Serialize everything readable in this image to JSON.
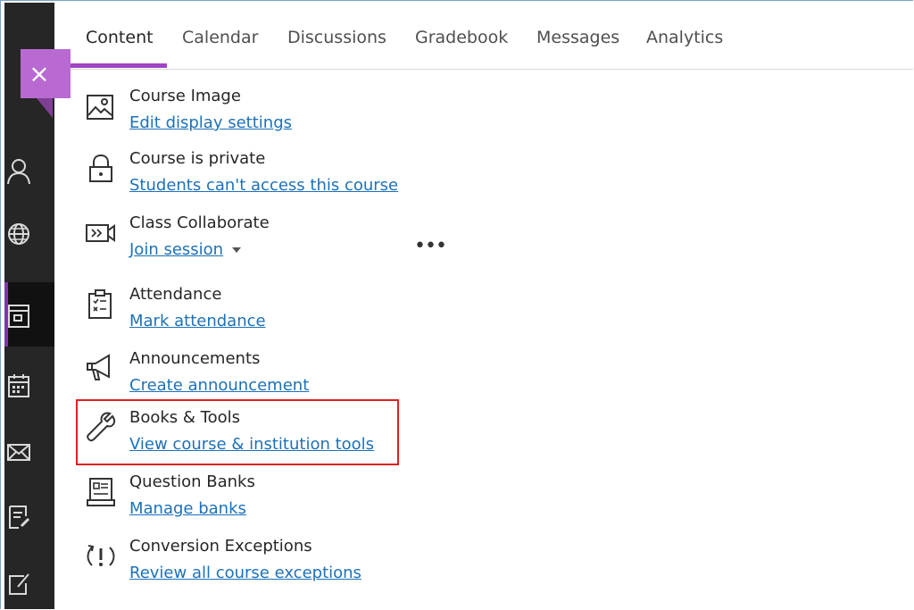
{
  "tabs": [
    {
      "label": "Content",
      "active": true
    },
    {
      "label": "Calendar",
      "active": false
    },
    {
      "label": "Discussions",
      "active": false
    },
    {
      "label": "Gradebook",
      "active": false
    },
    {
      "label": "Messages",
      "active": false
    },
    {
      "label": "Analytics",
      "active": false
    }
  ],
  "close_symbol": "×",
  "accent_color": "#a243c4",
  "link_color": "#1d71b8",
  "items": [
    {
      "title": "Course Image",
      "link": "Edit display settings",
      "icon": "image-icon"
    },
    {
      "title": "Course is private",
      "link": "Students can't access this course",
      "icon": "lock-icon"
    },
    {
      "title": "Class Collaborate",
      "link": "Join session",
      "icon": "video-icon",
      "has_dropdown": true
    },
    {
      "title": "Attendance",
      "link": "Mark attendance",
      "icon": "clipboard-icon"
    },
    {
      "title": "Announcements",
      "link": "Create announcement",
      "icon": "megaphone-icon"
    },
    {
      "title": "Books & Tools",
      "link": "View course & institution tools",
      "icon": "wrench-icon",
      "highlighted": true
    },
    {
      "title": "Question Banks",
      "link": "Manage banks",
      "icon": "question-bank-icon"
    },
    {
      "title": "Conversion Exceptions",
      "link": "Review all course exceptions",
      "icon": "exception-icon"
    }
  ],
  "more_symbol": "•••",
  "rail_icons": [
    "profile-icon",
    "globe-icon",
    "courses-icon",
    "calendar-icon",
    "mail-icon",
    "grades-icon",
    "edit-icon"
  ]
}
